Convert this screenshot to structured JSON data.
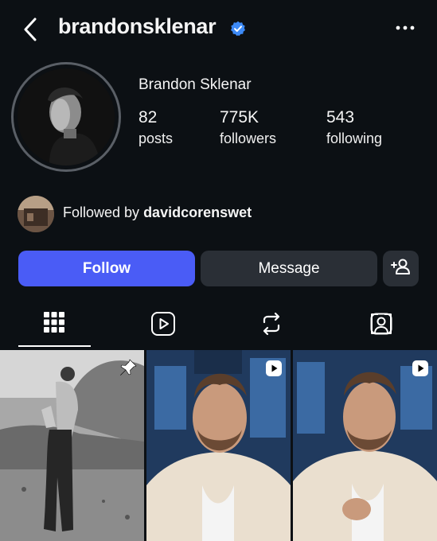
{
  "header": {
    "username": "brandonsklenar"
  },
  "profile": {
    "full_name": "Brandon Sklenar",
    "stats": [
      {
        "value": "82",
        "label": "posts"
      },
      {
        "value": "775K",
        "label": "followers"
      },
      {
        "value": "543",
        "label": "following"
      }
    ],
    "followed_by_prefix": "Followed by ",
    "followed_by_user": "davidcorenswet"
  },
  "actions": {
    "follow_label": "Follow",
    "message_label": "Message"
  },
  "tabs": [
    "grid",
    "reels",
    "reposts",
    "tagged"
  ],
  "colors": {
    "background": "#0c1014",
    "follow_button": "#4a5cf6",
    "secondary_button": "#2a2f36",
    "verified": "#3d8af7"
  }
}
